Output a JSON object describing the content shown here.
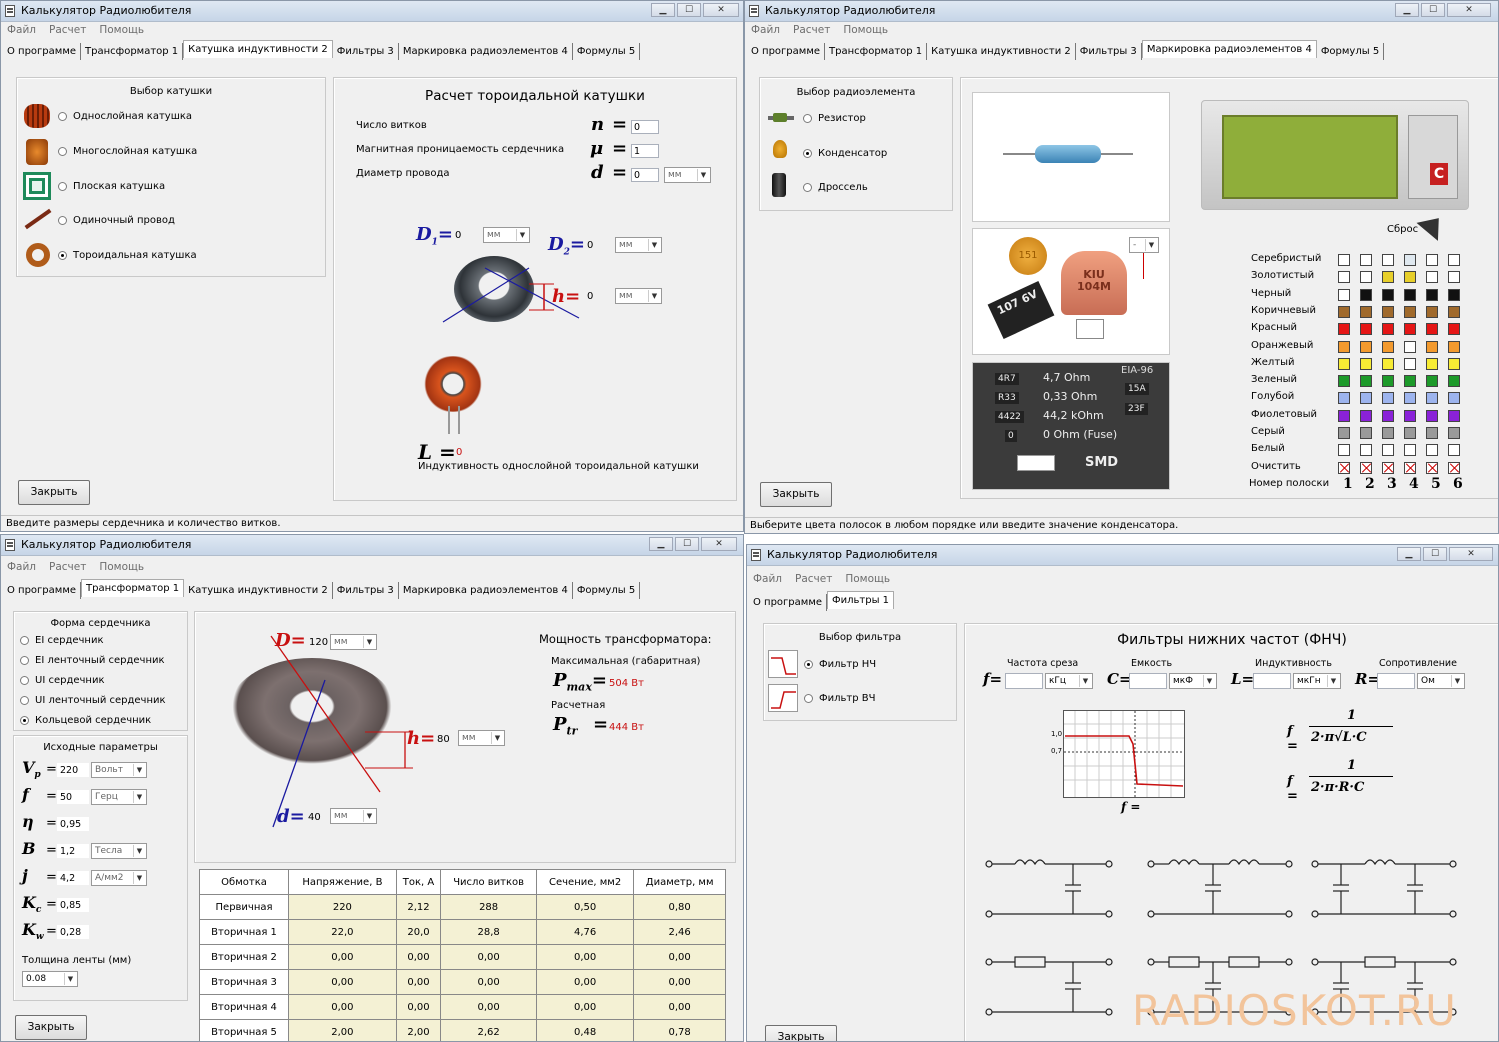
{
  "app": {
    "title": "Калькулятор Радиолюбителя",
    "menu": [
      "Файл",
      "Расчет",
      "Помощь"
    ],
    "close_label": "Закрыть"
  },
  "colors": {
    "accent_red": "#c81010",
    "formula_blue": "#1a1aa0",
    "value_cell": "#f4f1d4"
  },
  "w1": {
    "tabs": [
      "О программе",
      "Трансформатор 1",
      "Катушка индуктивности 2",
      "Фильтры 3",
      "Маркировка радиоэлементов 4",
      "Формулы 5"
    ],
    "group_title": "Выбор катушки",
    "options": [
      "Однослойная катушка",
      "Многослойная катушка",
      "Плоская катушка",
      "Одиночный провод",
      "Тороидальная катушка"
    ],
    "selected_index": 4,
    "heading": "Расчет тороидальной катушки",
    "params": [
      {
        "label": "Число витков",
        "sym": "n",
        "value": "0"
      },
      {
        "label": "Магнитная проницаемость сердечника",
        "sym": "μ",
        "value": "1"
      },
      {
        "label": "Диаметр провода",
        "sym": "d",
        "value": "0",
        "unit": "мм"
      }
    ],
    "d1": {
      "sym": "D",
      "sub": "1",
      "value": "0",
      "unit": "мм"
    },
    "d2": {
      "sym": "D",
      "sub": "2",
      "value": "0",
      "unit": "мм"
    },
    "h": {
      "sym": "h",
      "value": "0",
      "unit": "мм"
    },
    "l": {
      "sym": "L",
      "value": "0"
    },
    "result_label": "Индуктивность однослойной тороидальной катушки",
    "status": "Введите размеры сердечника и количество витков."
  },
  "w2": {
    "tabs": [
      "О программе",
      "Трансформатор 1",
      "Катушка индуктивности 2",
      "Фильтры 3",
      "Маркировка радиоэлементов 4",
      "Формулы 5"
    ],
    "group_title": "Выбор радиоэлемента",
    "options": [
      "Резистор",
      "Конденсатор",
      "Дроссель"
    ],
    "selected_index": 1,
    "reset_label": "Сброс",
    "cap_select": "-",
    "cap_labels": [
      "151",
      "107",
      "6V",
      "KIU",
      "104M"
    ],
    "smd": {
      "title": "EIA-96",
      "codes": [
        "4R7",
        "R33",
        "4422",
        "0"
      ],
      "values": [
        "4,7 Ohm",
        "0,33 Ohm",
        "44,2 kOhm",
        "0 Ohm (Fuse)"
      ],
      "eia": [
        "15A",
        "23F"
      ],
      "label": "SMD"
    },
    "color_names": [
      "Серебристый",
      "Золотистый",
      "Черный",
      "Коричневый",
      "Красный",
      "Оранжевый",
      "Желтый",
      "Зеленый",
      "Голубой",
      "Фиолетовый",
      "Серый",
      "Белый",
      "Очистить"
    ],
    "band_label": "Номер полоски",
    "bands": [
      "1",
      "2",
      "3",
      "4",
      "5",
      "6"
    ],
    "status": "Выберите цвета полосок в любом порядке или введите значение конденсатора."
  },
  "w3": {
    "tabs": [
      "О программе",
      "Трансформатор 1",
      "Катушка индуктивности 2",
      "Фильтры 3",
      "Маркировка радиоэлементов 4",
      "Формулы 5"
    ],
    "core_title": "Форма сердечника",
    "core_options": [
      "EI сердечник",
      "EI ленточный сердечник",
      "UI сердечник",
      "UI ленточный сердечник",
      "Кольцевой сердечник"
    ],
    "core_selected": 4,
    "init_title": "Исходные параметры",
    "params": [
      {
        "sym": "V",
        "sub": "p",
        "value": "220",
        "unit": "Вольт"
      },
      {
        "sym": "f",
        "sub": "",
        "value": "50",
        "unit": "Герц"
      },
      {
        "sym": "η",
        "sub": "",
        "value": "0,95",
        "unit": ""
      },
      {
        "sym": "B",
        "sub": "",
        "value": "1,2",
        "unit": "Тесла"
      },
      {
        "sym": "j",
        "sub": "",
        "value": "4,2",
        "unit": "А/мм2"
      },
      {
        "sym": "K",
        "sub": "c",
        "value": "0,85",
        "unit": ""
      },
      {
        "sym": "K",
        "sub": "w",
        "value": "0,28",
        "unit": ""
      }
    ],
    "tape_label": "Толщина ленты (мм)",
    "tape_value": "0.08",
    "D": {
      "sym": "D",
      "value": "120",
      "unit": "мм"
    },
    "h": {
      "sym": "h",
      "value": "80",
      "unit": "мм"
    },
    "d": {
      "sym": "d",
      "value": "40",
      "unit": "мм"
    },
    "power_title": "Мощность трансформатора:",
    "pmax_label": "Максимальная (габаритная)",
    "pmax_sym": "P",
    "pmax_sub": "max",
    "pmax_value": "504 Вт",
    "ptr_label": "Расчетная",
    "ptr_sym": "P",
    "ptr_sub": "tr",
    "ptr_value": "444 Вт",
    "table": {
      "headers": [
        "Обмотка",
        "Напряжение, В",
        "Ток, А",
        "Число витков",
        "Сечение, мм2",
        "Диаметр, мм"
      ],
      "rows": [
        [
          "Первичная",
          "220",
          "2,12",
          "288",
          "0,50",
          "0,80"
        ],
        [
          "Вторичная 1",
          "22,0",
          "20,0",
          "28,8",
          "4,76",
          "2,46"
        ],
        [
          "Вторичная 2",
          "0,00",
          "0,00",
          "0,00",
          "0,00",
          "0,00"
        ],
        [
          "Вторичная 3",
          "0,00",
          "0,00",
          "0,00",
          "0,00",
          "0,00"
        ],
        [
          "Вторичная 4",
          "0,00",
          "0,00",
          "0,00",
          "0,00",
          "0,00"
        ],
        [
          "Вторичная 5",
          "2,00",
          "2,00",
          "2,62",
          "0,48",
          "0,78"
        ]
      ]
    }
  },
  "w4": {
    "tabs": [
      "О программе",
      "Фильтры 1"
    ],
    "group_title": "Выбор фильтра",
    "options": [
      "Фильтр НЧ",
      "Фильтр ВЧ"
    ],
    "selected_index": 0,
    "heading": "Фильтры нижних частот (ФНЧ)",
    "fields": [
      {
        "title": "Частота среза",
        "sym": "f",
        "unit": "кГц"
      },
      {
        "title": "Емкость",
        "sym": "C",
        "unit": "мкФ"
      },
      {
        "title": "Индуктивность",
        "sym": "L",
        "unit": "мкГн"
      },
      {
        "title": "Сопротивление",
        "sym": "R",
        "unit": "Ом"
      }
    ],
    "graph_y": [
      "1,0",
      "0,7"
    ],
    "graph_x": "f =",
    "formula1": {
      "lhs": "f =",
      "num": "1",
      "den": "2·π√L·C"
    },
    "formula2": {
      "lhs": "f =",
      "num": "1",
      "den": "2·π·R·C"
    }
  },
  "watermark": "RADIOSKOT.RU"
}
